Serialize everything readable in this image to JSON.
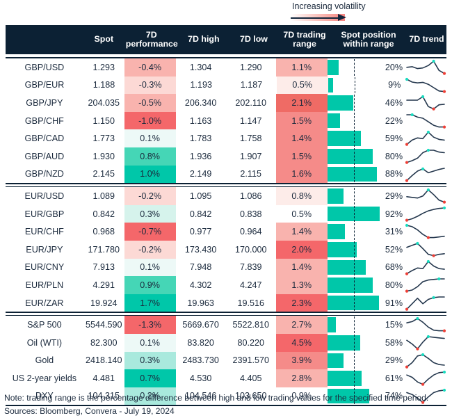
{
  "legend": {
    "label": "Increasing volatility",
    "icon": "gradient-arrow-right-icon"
  },
  "header": {
    "columns": [
      {
        "key": "name",
        "label": ""
      },
      {
        "key": "spot",
        "label": "Spot"
      },
      {
        "key": "perf",
        "label": "7D performance"
      },
      {
        "key": "high",
        "label": "7D high"
      },
      {
        "key": "low",
        "label": "7D low"
      },
      {
        "key": "range",
        "label": "7D trading range"
      },
      {
        "key": "pos",
        "label": "Spot position within range"
      },
      {
        "key": "trend",
        "label": "7D trend"
      }
    ]
  },
  "colors": {
    "header_bg": "#0c2134",
    "teal_strong": "#00c7a9",
    "teal_mid": "#45d6b6",
    "teal_light": "#a9e9dd",
    "teal_faint": "#edf9f7",
    "red_strong": "#f4676a",
    "red_mid": "#f58b89",
    "red_light": "#f9b3ae",
    "red_faint": "#fcd9d5",
    "red_faintest": "#fdece9",
    "white": "#ffffff",
    "spark_line": "#24374d",
    "spark_high": "#18dcc0",
    "spark_low": "#ee3f36"
  },
  "footer": {
    "note": "Note: trading range is the percentage difference between high and low trading values for the specified time period.",
    "sources": "Sources: Bloomberg, Convera - July 19, 2024"
  },
  "chart_data": {
    "type": "table",
    "title": "",
    "columns": [
      "",
      "Spot",
      "7D performance",
      "7D high",
      "7D low",
      "7D trading range",
      "Spot position within range",
      "7D trend"
    ],
    "groups": [
      {
        "name": "gbp-pairs",
        "rows": [
          {
            "name": "GBP/USD",
            "spot": "1.293",
            "perf": "-0.4%",
            "perf_value": -0.4,
            "perf_color": "#f9b3ae",
            "high": "1.304",
            "low": "1.290",
            "range": "1.1%",
            "range_value": 1.1,
            "range_color": "#f9b3ae",
            "pos": "20%",
            "pos_value": 20,
            "spark": [
              42,
              40,
              46,
              44,
              36,
              22,
              52,
              62
            ],
            "spark_high_idx": 5,
            "spark_low_idx": 7
          },
          {
            "name": "GBP/EUR",
            "spot": "1.188",
            "perf": "-0.3%",
            "perf_value": -0.3,
            "perf_color": "#fcd9d5",
            "high": "1.193",
            "low": "1.187",
            "range": "0.5%",
            "range_value": 0.5,
            "range_color": "#fdece9",
            "pos": "9%",
            "pos_value": 9,
            "spark": [
              20,
              30,
              33,
              31,
              38,
              50,
              62,
              64
            ],
            "spark_high_idx": 0,
            "spark_low_idx": 7
          },
          {
            "name": "GBP/JPY",
            "spot": "204.035",
            "perf": "-0.5%",
            "perf_value": -0.5,
            "perf_color": "#f9b3ae",
            "high": "206.340",
            "low": "202.110",
            "range": "2.1%",
            "range_value": 2.1,
            "range_color": "#ef6b65",
            "pos": "46%",
            "pos_value": 46,
            "spark": [
              36,
              36,
              36,
              24,
              58,
              66,
              52,
              50
            ],
            "spark_high_idx": 3,
            "spark_low_idx": 5
          },
          {
            "name": "GBP/CHF",
            "spot": "1.150",
            "perf": "-1.0%",
            "perf_value": -1.0,
            "perf_color": "#f4676a",
            "high": "1.163",
            "low": "1.147",
            "range": "1.5%",
            "range_value": 1.5,
            "range_color": "#f58b89",
            "pos": "22%",
            "pos_value": 22,
            "spark": [
              22,
              22,
              30,
              34,
              46,
              58,
              64,
              64
            ],
            "spark_high_idx": 1,
            "spark_low_idx": 7
          },
          {
            "name": "GBP/CAD",
            "spot": "1.773",
            "perf": "0.1%",
            "perf_value": 0.1,
            "perf_color": "#edf9f7",
            "high": "1.783",
            "low": "1.758",
            "range": "1.4%",
            "range_value": 1.4,
            "range_color": "#f58b89",
            "pos": "59%",
            "pos_value": 59,
            "spark": [
              64,
              52,
              46,
              48,
              30,
              44,
              50,
              52
            ],
            "spark_high_idx": 4,
            "spark_low_idx": 0
          },
          {
            "name": "GBP/AUD",
            "spot": "1.930",
            "perf": "0.8%",
            "perf_value": 0.8,
            "perf_color": "#45d6b6",
            "high": "1.936",
            "low": "1.907",
            "range": "1.5%",
            "range_value": 1.5,
            "range_color": "#f58b89",
            "pos": "80%",
            "pos_value": 80,
            "spark": [
              66,
              60,
              52,
              34,
              26,
              26,
              32,
              34
            ],
            "spark_high_idx": 4,
            "spark_low_idx": 0
          },
          {
            "name": "GBP/NZD",
            "spot": "2.145",
            "perf": "1.0%",
            "perf_value": 1.0,
            "perf_color": "#00c7a9",
            "high": "2.149",
            "low": "2.115",
            "range": "1.6%",
            "range_value": 1.6,
            "range_color": "#f58b89",
            "pos": "88%",
            "pos_value": 88,
            "spark": [
              68,
              50,
              34,
              26,
              40,
              34,
              28,
              24
            ],
            "spark_high_idx": 3,
            "spark_low_idx": 0
          }
        ]
      },
      {
        "name": "eur-pairs",
        "rows": [
          {
            "name": "EUR/USD",
            "spot": "1.089",
            "perf": "-0.2%",
            "perf_value": -0.2,
            "perf_color": "#fcd9d5",
            "high": "1.095",
            "low": "1.086",
            "range": "0.8%",
            "range_value": 0.8,
            "range_color": "#fdece9",
            "pos": "29%",
            "pos_value": 29,
            "spark": [
              44,
              46,
              48,
              42,
              24,
              38,
              54,
              60
            ],
            "spark_high_idx": 4,
            "spark_low_idx": 7
          },
          {
            "name": "EUR/GBP",
            "spot": "0.842",
            "perf": "0.3%",
            "perf_value": 0.3,
            "perf_color": "#d6f3ec",
            "high": "0.842",
            "low": "0.838",
            "range": "0.5%",
            "range_value": 0.5,
            "range_color": "#ffffff",
            "pos": "92%",
            "pos_value": 92,
            "spark": [
              66,
              60,
              50,
              38,
              28,
              22,
              18,
              16
            ],
            "spark_high_idx": 7,
            "spark_low_idx": 0
          },
          {
            "name": "EUR/CHF",
            "spot": "0.968",
            "perf": "-0.7%",
            "perf_value": -0.7,
            "perf_color": "#f4676a",
            "high": "0.977",
            "low": "0.964",
            "range": "1.4%",
            "range_value": 1.4,
            "range_color": "#f9b3ae",
            "pos": "31%",
            "pos_value": 31,
            "spark": [
              20,
              24,
              34,
              48,
              58,
              58,
              56,
              54
            ],
            "spark_high_idx": 0,
            "spark_low_idx": 4
          },
          {
            "name": "EUR/JPY",
            "spot": "171.780",
            "perf": "-0.2%",
            "perf_value": -0.2,
            "perf_color": "#fcd9d5",
            "high": "173.430",
            "low": "170.000",
            "range": "2.0%",
            "range_value": 2.0,
            "range_color": "#f4676a",
            "pos": "52%",
            "pos_value": 52,
            "spark": [
              36,
              30,
              24,
              40,
              58,
              62,
              58,
              56
            ],
            "spark_high_idx": 2,
            "spark_low_idx": 5
          },
          {
            "name": "EUR/CNY",
            "spot": "7.913",
            "perf": "0.1%",
            "perf_value": 0.1,
            "perf_color": "#edf9f7",
            "high": "7.948",
            "low": "7.839",
            "range": "1.4%",
            "range_value": 1.4,
            "range_color": "#f9b3ae",
            "pos": "68%",
            "pos_value": 68,
            "spark": [
              64,
              54,
              46,
              48,
              26,
              40,
              48,
              50
            ],
            "spark_high_idx": 4,
            "spark_low_idx": 0
          },
          {
            "name": "EUR/PLN",
            "spot": "4.291",
            "perf": "0.9%",
            "perf_value": 0.9,
            "perf_color": "#45d6b6",
            "high": "4.302",
            "low": "4.247",
            "range": "1.3%",
            "range_value": 1.3,
            "range_color": "#f9b3ae",
            "pos": "80%",
            "pos_value": 80,
            "spark": [
              64,
              60,
              48,
              30,
              24,
              22,
              20,
              20
            ],
            "spark_high_idx": 6,
            "spark_low_idx": 0
          },
          {
            "name": "EUR/ZAR",
            "spot": "19.924",
            "perf": "1.7%",
            "perf_value": 1.7,
            "perf_color": "#00c7a9",
            "high": "19.963",
            "low": "19.516",
            "range": "2.3%",
            "range_value": 2.3,
            "range_color": "#f4676a",
            "pos": "91%",
            "pos_value": 91,
            "spark": [
              62,
              44,
              26,
              44,
              30,
              24,
              22,
              22
            ],
            "spark_high_idx": 5,
            "spark_low_idx": 0
          }
        ]
      },
      {
        "name": "markets",
        "rows": [
          {
            "name": "S&P 500",
            "spot": "5544.590",
            "perf": "-1.3%",
            "perf_value": -1.3,
            "perf_color": "#f4676a",
            "high": "5669.670",
            "low": "5522.810",
            "range": "2.7%",
            "range_value": 2.7,
            "range_color": "#f9b3ae",
            "pos": "15%",
            "pos_value": 15,
            "spark": [
              36,
              32,
              22,
              34,
              50,
              60,
              62,
              62
            ],
            "spark_high_idx": 2,
            "spark_low_idx": 7
          },
          {
            "name": "Oil (WTI)",
            "spot": "82.300",
            "perf": "0.1%",
            "perf_value": 0.1,
            "perf_color": "#edf9f7",
            "high": "83.820",
            "low": "80.220",
            "range": "4.5%",
            "range_value": 4.5,
            "range_color": "#f4676a",
            "pos": "58%",
            "pos_value": 58,
            "spark": [
              34,
              46,
              62,
              40,
              22,
              24,
              26,
              28
            ],
            "spark_high_idx": 4,
            "spark_low_idx": 2
          },
          {
            "name": "Gold",
            "spot": "2418.140",
            "perf": "0.3%",
            "perf_value": 0.3,
            "perf_color": "#a9e9dd",
            "high": "2483.730",
            "low": "2391.570",
            "range": "3.9%",
            "range_value": 3.9,
            "range_color": "#f58b89",
            "pos": "29%",
            "pos_value": 29,
            "spark": [
              62,
              48,
              26,
              22,
              34,
              48,
              54,
              56
            ],
            "spark_high_idx": 3,
            "spark_low_idx": 0
          },
          {
            "name": "US 2-year yields",
            "spot": "4.481",
            "perf": "0.7%",
            "perf_value": 0.7,
            "perf_color": "#00c7a9",
            "high": "4.530",
            "low": "4.405",
            "range": "2.8%",
            "range_value": 2.8,
            "range_color": "#f9b3ae",
            "pos": "61%",
            "pos_value": 61,
            "spark": [
              30,
              38,
              54,
              62,
              44,
              30,
              22,
              20
            ],
            "spark_high_idx": 7,
            "spark_low_idx": 3
          },
          {
            "name": "DXY",
            "spot": "104.315",
            "perf": "0.2%",
            "perf_value": 0.2,
            "perf_color": "#a9e9dd",
            "high": "104.546",
            "low": "103.650",
            "range": "0.9%",
            "range_value": 0.9,
            "range_color": "#ffffff",
            "pos": "74%",
            "pos_value": 74,
            "spark": [
              30,
              36,
              48,
              62,
              44,
              30,
              24,
              22
            ],
            "spark_high_idx": 7,
            "spark_low_idx": 3
          }
        ]
      }
    ]
  }
}
